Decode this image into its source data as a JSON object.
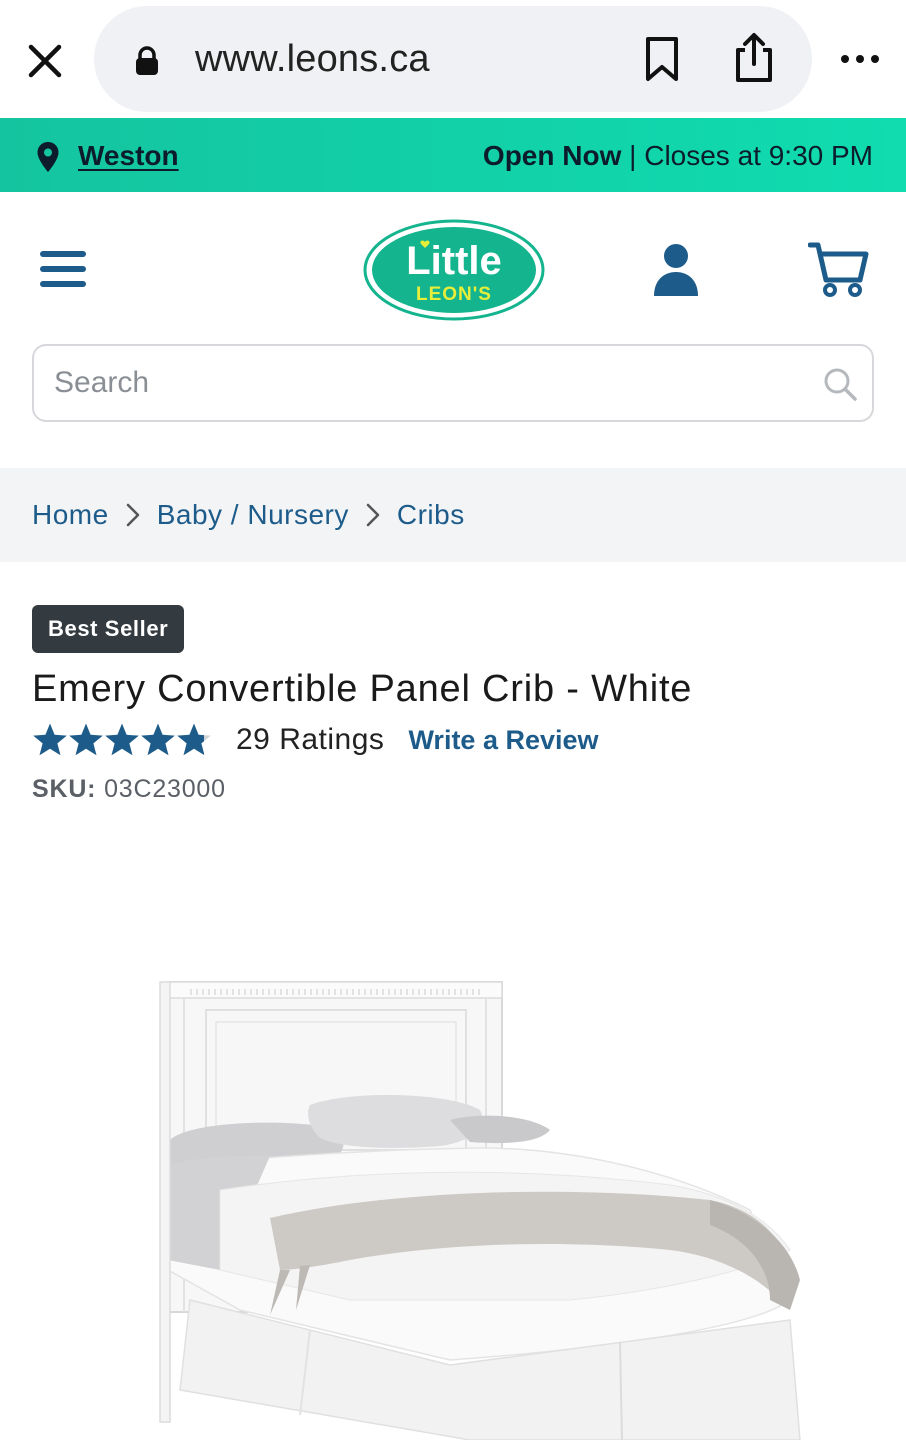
{
  "browser": {
    "url": "www.leons.ca"
  },
  "store_bar": {
    "store_name": "Weston",
    "status": "Open Now",
    "separator": "|",
    "closes": "Closes at 9:30 PM",
    "color": "#14c4a0"
  },
  "header": {
    "logo_line1": "Little",
    "logo_line2": "LEON'S"
  },
  "search": {
    "placeholder": "Search"
  },
  "breadcrumb": {
    "items": [
      "Home",
      "Baby / Nursery",
      "Cribs"
    ]
  },
  "product": {
    "badge": "Best Seller",
    "title": "Emery Convertible Panel Crib - White",
    "rating_stars": 4.8,
    "ratings_count": "29 Ratings",
    "write_review": "Write a Review",
    "sku_label": "SKU:",
    "sku_value": "03C23000"
  },
  "colors": {
    "brand_blue": "#1d5c8a",
    "brand_teal": "#14c4a0",
    "badge_bg": "#333b40"
  }
}
